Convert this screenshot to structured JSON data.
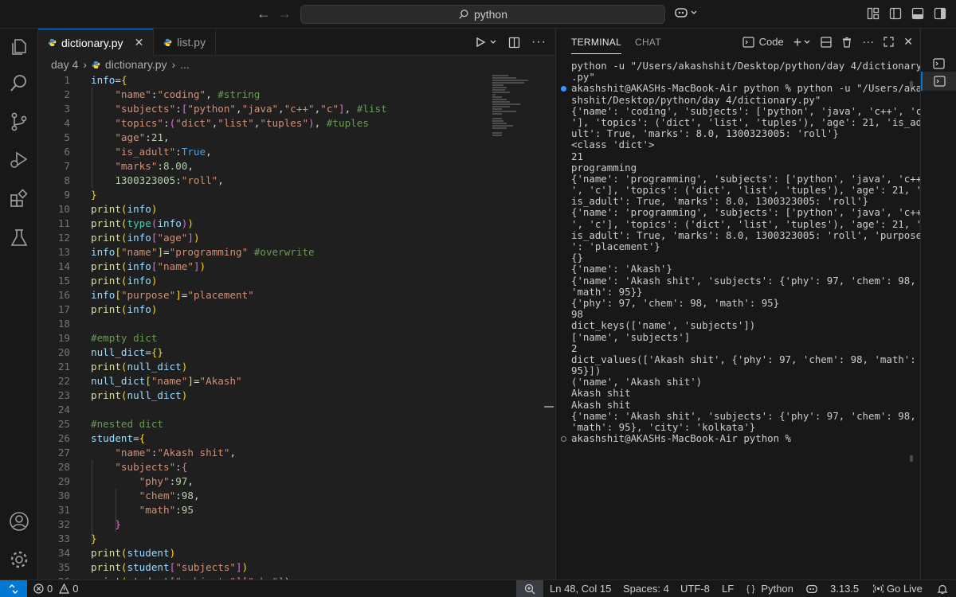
{
  "titlebar": {
    "search_text": "python",
    "back_icon": "arrow-left-icon",
    "forward_icon": "arrow-right-icon"
  },
  "activity_bar": [
    "explorer-icon",
    "search-icon",
    "source-control-icon",
    "run-debug-icon",
    "extensions-icon",
    "testing-icon",
    "account-icon",
    "settings-gear-icon"
  ],
  "editor": {
    "tabs": [
      {
        "label": "dictionary.py",
        "active": true
      },
      {
        "label": "list.py",
        "active": false
      }
    ],
    "breadcrumb": {
      "folder": "day 4",
      "file": "dictionary.py",
      "more": "..."
    },
    "current_line": 48
  },
  "code_lines": [
    [
      [
        "v",
        "info"
      ],
      [
        "o",
        "="
      ],
      [
        "b1",
        "{"
      ]
    ],
    [
      [
        "o",
        "    "
      ],
      [
        "s",
        "\"name\""
      ],
      [
        "o",
        ":"
      ],
      [
        "s",
        "\"coding\""
      ],
      [
        "o",
        ", "
      ],
      [
        "c",
        "#string"
      ]
    ],
    [
      [
        "o",
        "    "
      ],
      [
        "s",
        "\"subjects\""
      ],
      [
        "o",
        ":"
      ],
      [
        "b2",
        "["
      ],
      [
        "s",
        "\"python\""
      ],
      [
        "o",
        ","
      ],
      [
        "s",
        "\"java\""
      ],
      [
        "o",
        ","
      ],
      [
        "s",
        "\"c++\""
      ],
      [
        "o",
        ","
      ],
      [
        "s",
        "\"c\""
      ],
      [
        "b2",
        "]"
      ],
      [
        "o",
        ", "
      ],
      [
        "c",
        "#list"
      ]
    ],
    [
      [
        "o",
        "    "
      ],
      [
        "s",
        "\"topics\""
      ],
      [
        "o",
        ":"
      ],
      [
        "b2",
        "("
      ],
      [
        "s",
        "\"dict\""
      ],
      [
        "o",
        ","
      ],
      [
        "s",
        "\"list\""
      ],
      [
        "o",
        ","
      ],
      [
        "s",
        "\"tuples\""
      ],
      [
        "b2",
        ")"
      ],
      [
        "o",
        ", "
      ],
      [
        "c",
        "#tuples"
      ]
    ],
    [
      [
        "o",
        "    "
      ],
      [
        "s",
        "\"age\""
      ],
      [
        "o",
        ":"
      ],
      [
        "n",
        "21"
      ],
      [
        "o",
        ","
      ]
    ],
    [
      [
        "o",
        "    "
      ],
      [
        "s",
        "\"is_adult\""
      ],
      [
        "o",
        ":"
      ],
      [
        "k",
        "True"
      ],
      [
        "o",
        ","
      ]
    ],
    [
      [
        "o",
        "    "
      ],
      [
        "s",
        "\"marks\""
      ],
      [
        "o",
        ":"
      ],
      [
        "n",
        "8.00"
      ],
      [
        "o",
        ","
      ]
    ],
    [
      [
        "o",
        "    "
      ],
      [
        "n",
        "1300323005"
      ],
      [
        "o",
        ":"
      ],
      [
        "s",
        "\"roll\""
      ],
      [
        "o",
        ","
      ]
    ],
    [
      [
        "b1",
        "}"
      ]
    ],
    [
      [
        "f",
        "print"
      ],
      [
        "b1",
        "("
      ],
      [
        "v",
        "info"
      ],
      [
        "b1",
        ")"
      ]
    ],
    [
      [
        "f",
        "print"
      ],
      [
        "b1",
        "("
      ],
      [
        "t",
        "type"
      ],
      [
        "b2",
        "("
      ],
      [
        "v",
        "info"
      ],
      [
        "b2",
        ")"
      ],
      [
        "b1",
        ")"
      ]
    ],
    [
      [
        "f",
        "print"
      ],
      [
        "b1",
        "("
      ],
      [
        "v",
        "info"
      ],
      [
        "b2",
        "["
      ],
      [
        "s",
        "\"age\""
      ],
      [
        "b2",
        "]"
      ],
      [
        "b1",
        ")"
      ]
    ],
    [
      [
        "v",
        "info"
      ],
      [
        "b1",
        "["
      ],
      [
        "s",
        "\"name\""
      ],
      [
        "b1",
        "]"
      ],
      [
        "o",
        "="
      ],
      [
        "s",
        "\"programming\""
      ],
      [
        "o",
        " "
      ],
      [
        "c",
        "#overwrite"
      ]
    ],
    [
      [
        "f",
        "print"
      ],
      [
        "b1",
        "("
      ],
      [
        "v",
        "info"
      ],
      [
        "b2",
        "["
      ],
      [
        "s",
        "\"name\""
      ],
      [
        "b2",
        "]"
      ],
      [
        "b1",
        ")"
      ]
    ],
    [
      [
        "f",
        "print"
      ],
      [
        "b1",
        "("
      ],
      [
        "v",
        "info"
      ],
      [
        "b1",
        ")"
      ]
    ],
    [
      [
        "v",
        "info"
      ],
      [
        "b1",
        "["
      ],
      [
        "s",
        "\"purpose\""
      ],
      [
        "b1",
        "]"
      ],
      [
        "o",
        "="
      ],
      [
        "s",
        "\"placement\""
      ]
    ],
    [
      [
        "f",
        "print"
      ],
      [
        "b1",
        "("
      ],
      [
        "v",
        "info"
      ],
      [
        "b1",
        ")"
      ]
    ],
    [],
    [
      [
        "c",
        "#empty dict"
      ]
    ],
    [
      [
        "v",
        "null_dict"
      ],
      [
        "o",
        "="
      ],
      [
        "b1",
        "{}"
      ]
    ],
    [
      [
        "f",
        "print"
      ],
      [
        "b1",
        "("
      ],
      [
        "v",
        "null_dict"
      ],
      [
        "b1",
        ")"
      ]
    ],
    [
      [
        "v",
        "null_dict"
      ],
      [
        "b1",
        "["
      ],
      [
        "s",
        "\"name\""
      ],
      [
        "b1",
        "]"
      ],
      [
        "o",
        "="
      ],
      [
        "s",
        "\"Akash\""
      ]
    ],
    [
      [
        "f",
        "print"
      ],
      [
        "b1",
        "("
      ],
      [
        "v",
        "null_dict"
      ],
      [
        "b1",
        ")"
      ]
    ],
    [],
    [
      [
        "c",
        "#nested dict"
      ]
    ],
    [
      [
        "v",
        "student"
      ],
      [
        "o",
        "="
      ],
      [
        "b1",
        "{"
      ]
    ],
    [
      [
        "o",
        "    "
      ],
      [
        "s",
        "\"name\""
      ],
      [
        "o",
        ":"
      ],
      [
        "s",
        "\"Akash shit\""
      ],
      [
        "o",
        ","
      ]
    ],
    [
      [
        "o",
        "    "
      ],
      [
        "s",
        "\"subjects\""
      ],
      [
        "o",
        ":"
      ],
      [
        "b2",
        "{"
      ]
    ],
    [
      [
        "o",
        "        "
      ],
      [
        "s",
        "\"phy\""
      ],
      [
        "o",
        ":"
      ],
      [
        "n",
        "97"
      ],
      [
        "o",
        ","
      ]
    ],
    [
      [
        "o",
        "        "
      ],
      [
        "s",
        "\"chem\""
      ],
      [
        "o",
        ":"
      ],
      [
        "n",
        "98"
      ],
      [
        "o",
        ","
      ]
    ],
    [
      [
        "o",
        "        "
      ],
      [
        "s",
        "\"math\""
      ],
      [
        "o",
        ":"
      ],
      [
        "n",
        "95"
      ]
    ],
    [
      [
        "o",
        "    "
      ],
      [
        "b2",
        "}"
      ]
    ],
    [
      [
        "b1",
        "}"
      ]
    ],
    [
      [
        "f",
        "print"
      ],
      [
        "b1",
        "("
      ],
      [
        "v",
        "student"
      ],
      [
        "b1",
        ")"
      ]
    ],
    [
      [
        "f",
        "print"
      ],
      [
        "b1",
        "("
      ],
      [
        "v",
        "student"
      ],
      [
        "b2",
        "["
      ],
      [
        "s",
        "\"subjects\""
      ],
      [
        "b2",
        "]"
      ],
      [
        "b1",
        ")"
      ]
    ],
    [
      [
        "f",
        "print"
      ],
      [
        "b1",
        "("
      ],
      [
        "v",
        "student"
      ],
      [
        "b2",
        "["
      ],
      [
        "s",
        "\"subjects\""
      ],
      [
        "b2",
        "]"
      ],
      [
        "b2",
        "["
      ],
      [
        "s",
        "\"phy\""
      ],
      [
        "b2",
        "]"
      ],
      [
        "b1",
        ")"
      ]
    ]
  ],
  "panel": {
    "tabs": [
      "TERMINAL",
      "CHAT"
    ],
    "terminal_name": "Code",
    "lines": [
      "python -u \"/Users/akashshit/Desktop/python/day 4/dictionary",
      ".py\"",
      "akashshit@AKASHs-MacBook-Air python % python -u \"/Users/aka",
      "shshit/Desktop/python/day 4/dictionary.py\"",
      "{'name': 'coding', 'subjects': ['python', 'java', 'c++', 'c",
      "'], 'topics': ('dict', 'list', 'tuples'), 'age': 21, 'is_ad",
      "ult': True, 'marks': 8.0, 1300323005: 'roll'}",
      "<class 'dict'>",
      "21",
      "programming",
      "{'name': 'programming', 'subjects': ['python', 'java', 'c++",
      "', 'c'], 'topics': ('dict', 'list', 'tuples'), 'age': 21, '",
      "is_adult': True, 'marks': 8.0, 1300323005: 'roll'}",
      "{'name': 'programming', 'subjects': ['python', 'java', 'c++",
      "', 'c'], 'topics': ('dict', 'list', 'tuples'), 'age': 21, '",
      "is_adult': True, 'marks': 8.0, 1300323005: 'roll', 'purpose",
      "': 'placement'}",
      "{}",
      "{'name': 'Akash'}",
      "{'name': 'Akash shit', 'subjects': {'phy': 97, 'chem': 98,",
      "'math': 95}}",
      "{'phy': 97, 'chem': 98, 'math': 95}",
      "98",
      "dict_keys(['name', 'subjects'])",
      "['name', 'subjects']",
      "2",
      "dict_values(['Akash shit', {'phy': 97, 'chem': 98, 'math':",
      "95}])",
      "('name', 'Akash shit')",
      "Akash shit",
      "Akash shit",
      "{'name': 'Akash shit', 'subjects': {'phy': 97, 'chem': 98,",
      "'math': 95}, 'city': 'kolkata'}",
      "akashshit@AKASHs-MacBook-Air python % "
    ]
  },
  "statusbar": {
    "errors": "0",
    "warnings": "0",
    "position": "Ln 48, Col 15",
    "spaces": "Spaces: 4",
    "encoding": "UTF-8",
    "eol": "LF",
    "language_braces": "{ }",
    "language": "Python",
    "python_version": "3.13.5",
    "go_live": "Go Live"
  },
  "colors": {
    "accent": "#0078d4",
    "background": "#1f1f1f",
    "sidebar": "#181818",
    "dot_blue": "#3794ff",
    "dot_gray": "#8b8b8b"
  }
}
